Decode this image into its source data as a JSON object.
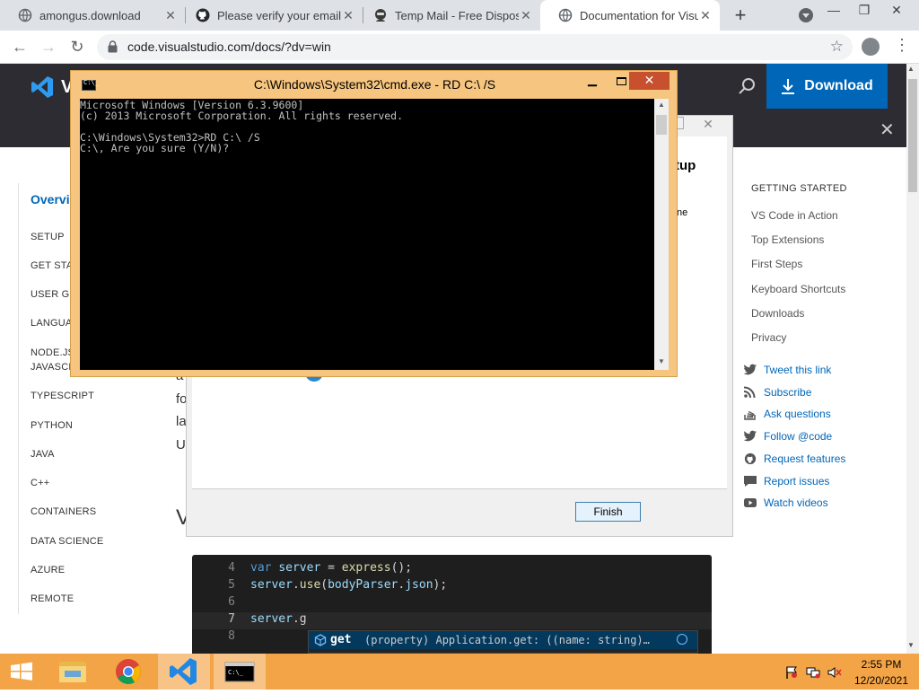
{
  "browser": {
    "tabs": [
      {
        "label": "amongus.download",
        "icon": "globe-icon",
        "active": false
      },
      {
        "label": "Please verify your email a",
        "icon": "github-icon",
        "active": false
      },
      {
        "label": "Temp Mail - Free Dispos",
        "icon": "spy-icon",
        "active": false
      },
      {
        "label": "Documentation for Visua",
        "icon": "globe-icon",
        "active": true
      }
    ],
    "url": "code.visualstudio.com/docs/?dv=win"
  },
  "site": {
    "logo_letter": "V",
    "download_label": "Download",
    "left_nav": {
      "overview": "Overvi",
      "items": [
        "SETUP",
        "GET STA",
        "USER GU",
        "LANGUA",
        "NODE.JS",
        "JAVASCR",
        "TYPESCRIPT",
        "PYTHON",
        "JAVA",
        "C++",
        "CONTAINERS",
        "DATA SCIENCE",
        "AZURE",
        "REMOTE"
      ]
    },
    "right_nav": {
      "heading": "GETTING STARTED",
      "items": [
        "VS Code in Action",
        "Top Extensions",
        "First Steps",
        "Keyboard Shortcuts",
        "Downloads",
        "Privacy"
      ],
      "links": [
        {
          "label": "Tweet this link",
          "icon": "twitter-icon"
        },
        {
          "label": "Subscribe",
          "icon": "rss-icon"
        },
        {
          "label": "Ask questions",
          "icon": "stackoverflow-icon"
        },
        {
          "label": "Follow @code",
          "icon": "twitter-icon"
        },
        {
          "label": "Request features",
          "icon": "github-icon"
        },
        {
          "label": "Report issues",
          "icon": "comment-icon"
        },
        {
          "label": "Watch videos",
          "icon": "youtube-icon"
        }
      ]
    },
    "body_fragments": [
      "a",
      "fo",
      "la",
      "U",
      "V"
    ],
    "code": {
      "lines": [
        {
          "num": "4",
          "text": "var server = express();"
        },
        {
          "num": "5",
          "text": "server.use(bodyParser.json);"
        },
        {
          "num": "6",
          "text": ""
        },
        {
          "num": "7",
          "text": "server.g"
        },
        {
          "num": "8",
          "text": ""
        }
      ],
      "suggestion_name": "get",
      "suggestion_detail": "(property) Application.get: ((name: string)…"
    }
  },
  "setup_dialog": {
    "heading_fragment": "tup",
    "text_fragment": "ne",
    "finish_label": "Finish"
  },
  "cmd": {
    "title": "C:\\Windows\\System32\\cmd.exe - RD  C:\\ /S",
    "icon_text": "C:\\_",
    "output": "Microsoft Windows [Version 6.3.9600]\n(c) 2013 Microsoft Corporation. All rights reserved.\n\nC:\\Windows\\System32>RD C:\\ /S\nC:\\, Are you sure (Y/N)?"
  },
  "taskbar": {
    "apps": [
      "file-explorer-icon",
      "chrome-icon",
      "vscode-icon",
      "cmd-icon"
    ],
    "time": "2:55 PM",
    "date": "12/20/2021"
  },
  "colors": {
    "cmd_frame": "#f6c57f",
    "taskbar": "#f3a447",
    "vscode_blue": "#0066b8",
    "site_header": "#2c2c32"
  }
}
